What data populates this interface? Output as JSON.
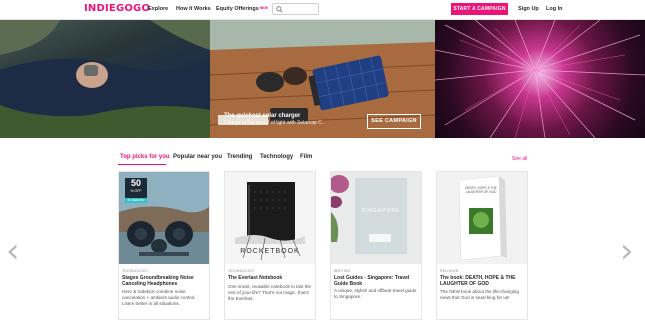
{
  "nav": {
    "logo": "INDIEGOGO",
    "links": [
      {
        "label": "Explore"
      },
      {
        "label": "How It Works"
      },
      {
        "label": "Equity Offerings",
        "badge": "NEW"
      }
    ],
    "search_placeholder": "",
    "cta": "START A CAMPAIGN",
    "signup": "Sign Up",
    "login": "Log In"
  },
  "hero": {
    "title": "The quickest solar charger",
    "subtitle": "Charge at the speed of light with Solarcap C.",
    "button": "SEE CAMPAIGN"
  },
  "tabs": {
    "items": [
      {
        "label": "Top picks for you",
        "active": true
      },
      {
        "label": "Popular near you",
        "active": false
      },
      {
        "label": "Trending",
        "active": false
      },
      {
        "label": "Technology",
        "active": false
      },
      {
        "label": "Film",
        "active": false
      }
    ],
    "see_all": "See all"
  },
  "cards": [
    {
      "category": "TECHNOLOGY",
      "title": "Stages Groundbreaking Noise Canceling Headphones",
      "description": "Hero & Sidekick combine noise cancelation + ambient audio control. Listen better in all situations.",
      "badge_number": "50",
      "badge_sub": "% OFF",
      "badge_tag": "IN DEMAND"
    },
    {
      "category": "TECHNOLOGY",
      "title": "The Everlast Notebook",
      "description": "One smart, reusable notebook to last the rest of your life? That's not magic, that's the Everlast.",
      "image_text": "ROCKETBOOK"
    },
    {
      "category": "WRITING",
      "title": "Lost Guides - Singapore: Travel Guide Book",
      "description": "A unique, stylish and offbeat travel guide to Singapore.",
      "image_text": "SINGAPORE"
    },
    {
      "category": "RELIGION",
      "title": "The book: DEATH, HOPE & THE LAUGHTER OF GOD",
      "description": "The NEW book about the life-changing news that God is searching for us!",
      "image_text": "DEATH, HOPE & THE LAUGHTER OF GOD"
    }
  ],
  "colors": {
    "brand": "#eb1478"
  }
}
